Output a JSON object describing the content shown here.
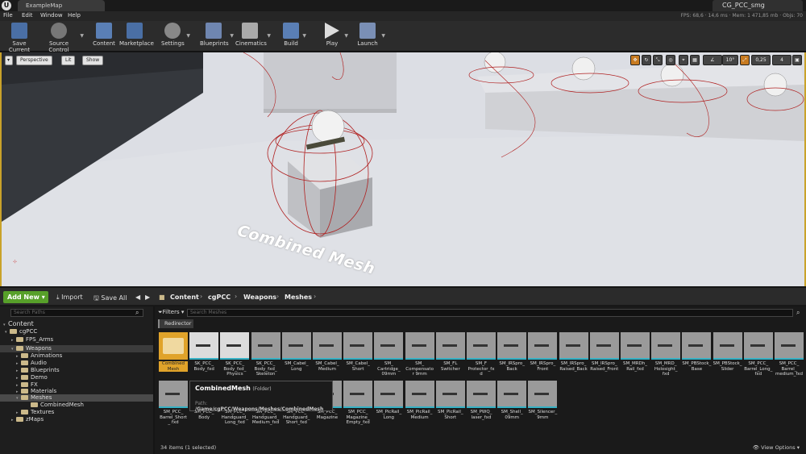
{
  "window": {
    "map_tab": "ExampleMap",
    "project_tab": "CG_PCC_smg",
    "stats": "FPS: 68,6 · 14,6 ms · Mem: 1 471,85 mb · Objs: 70"
  },
  "menu": [
    "File",
    "Edit",
    "Window",
    "Help"
  ],
  "toolbar": {
    "save_current": "Save Current",
    "source_control": "Source Control",
    "content": "Content",
    "marketplace": "Marketplace",
    "settings": "Settings",
    "blueprints": "Blueprints",
    "cinematics": "Cinematics",
    "build": "Build",
    "play": "Play",
    "launch": "Launch"
  },
  "viewport": {
    "perspective": "Perspective",
    "lit": "Lit",
    "show": "Show",
    "angle_snap": "10°",
    "scale_snap": "0,25",
    "camera_speed": "4",
    "label": "Combined Mesh"
  },
  "content_browser": {
    "add_new": "Add New",
    "import": "Import",
    "save_all": "Save All",
    "breadcrumb": [
      "Content",
      "cgPCC",
      "Weapons",
      "Meshes"
    ],
    "search_paths_placeholder": "Search Paths",
    "search_assets_placeholder": "Search Meshes",
    "filters": "Filters",
    "redirector": "Redirector",
    "tree": {
      "content": "Content",
      "cgpcc": "cgPCC",
      "fps_arms": "FPS_Arms",
      "weapons": "Weapons",
      "animations": "Animations",
      "audio": "Audio",
      "blueprints": "Blueprints",
      "demo": "Demo",
      "fx": "FX",
      "materials": "Materials",
      "meshes": "Meshes",
      "combinedmesh": "CombinedMesh",
      "textures": "Textures",
      "zmaps": "zMaps"
    },
    "assets_row1": [
      "Combined Mesh",
      "SK_PCC_ Body_fxd",
      "SK_PCC_ Body_fxd_ Physics",
      "SK_PCC_ Body_fxd_ Skeleton",
      "SM_Cabel_ Long",
      "SM_Cabel_ Medium",
      "SM_Cabel_ Short",
      "SM_ Cartridge_ 09mm",
      "SM_ Compensator 9mm",
      "SM_FL Switcher",
      "SM_F Protector_fxd",
      "SM_IRSpro_ Back",
      "SM_IRSpro_ Front",
      "SM_IRSpro_ Raised_Back",
      "SM_IRSpro_ Raised_Front",
      "SM_MRDh_ Rail_fxd",
      "SM_MRD_ Holosight_ fxd",
      "SM_PBStock_ Base",
      "SM_PBStock_ Slider",
      "SM_PCC_ Barrel_Long_ fxd",
      "SM_PCC_ Barrel_ medium_fxd"
    ],
    "assets_row2": [
      "SM_PCC_ Barrel_Short_ fxd",
      "SM_PCC_ Body",
      "SM_PCC_ Handguard_ Long_fxd",
      "SM_PCC_ Handguard_ Medium_fxd",
      "SM_PCC_ Handguard_ Short_fxd",
      "SM_PCC_ Magazine",
      "SM_PCC_ Magazine_ Empty_fxd",
      "SM_PicRail_ Long",
      "SM_PicRail_ Medium",
      "SM_PicRail_ Short",
      "SM_PWQ_ laser_fxd",
      "SM_Shell_ 09mm",
      "SM_Silencer_ 9mm"
    ],
    "tooltip_title": "CombinedMesh",
    "tooltip_type": "(Folder)",
    "tooltip_path_label": "Path:",
    "tooltip_path": "/Game/cgPCC/Weapons/Meshes/CombinedMesh",
    "status": "34 items (1 selected)",
    "view_options": "View Options"
  }
}
